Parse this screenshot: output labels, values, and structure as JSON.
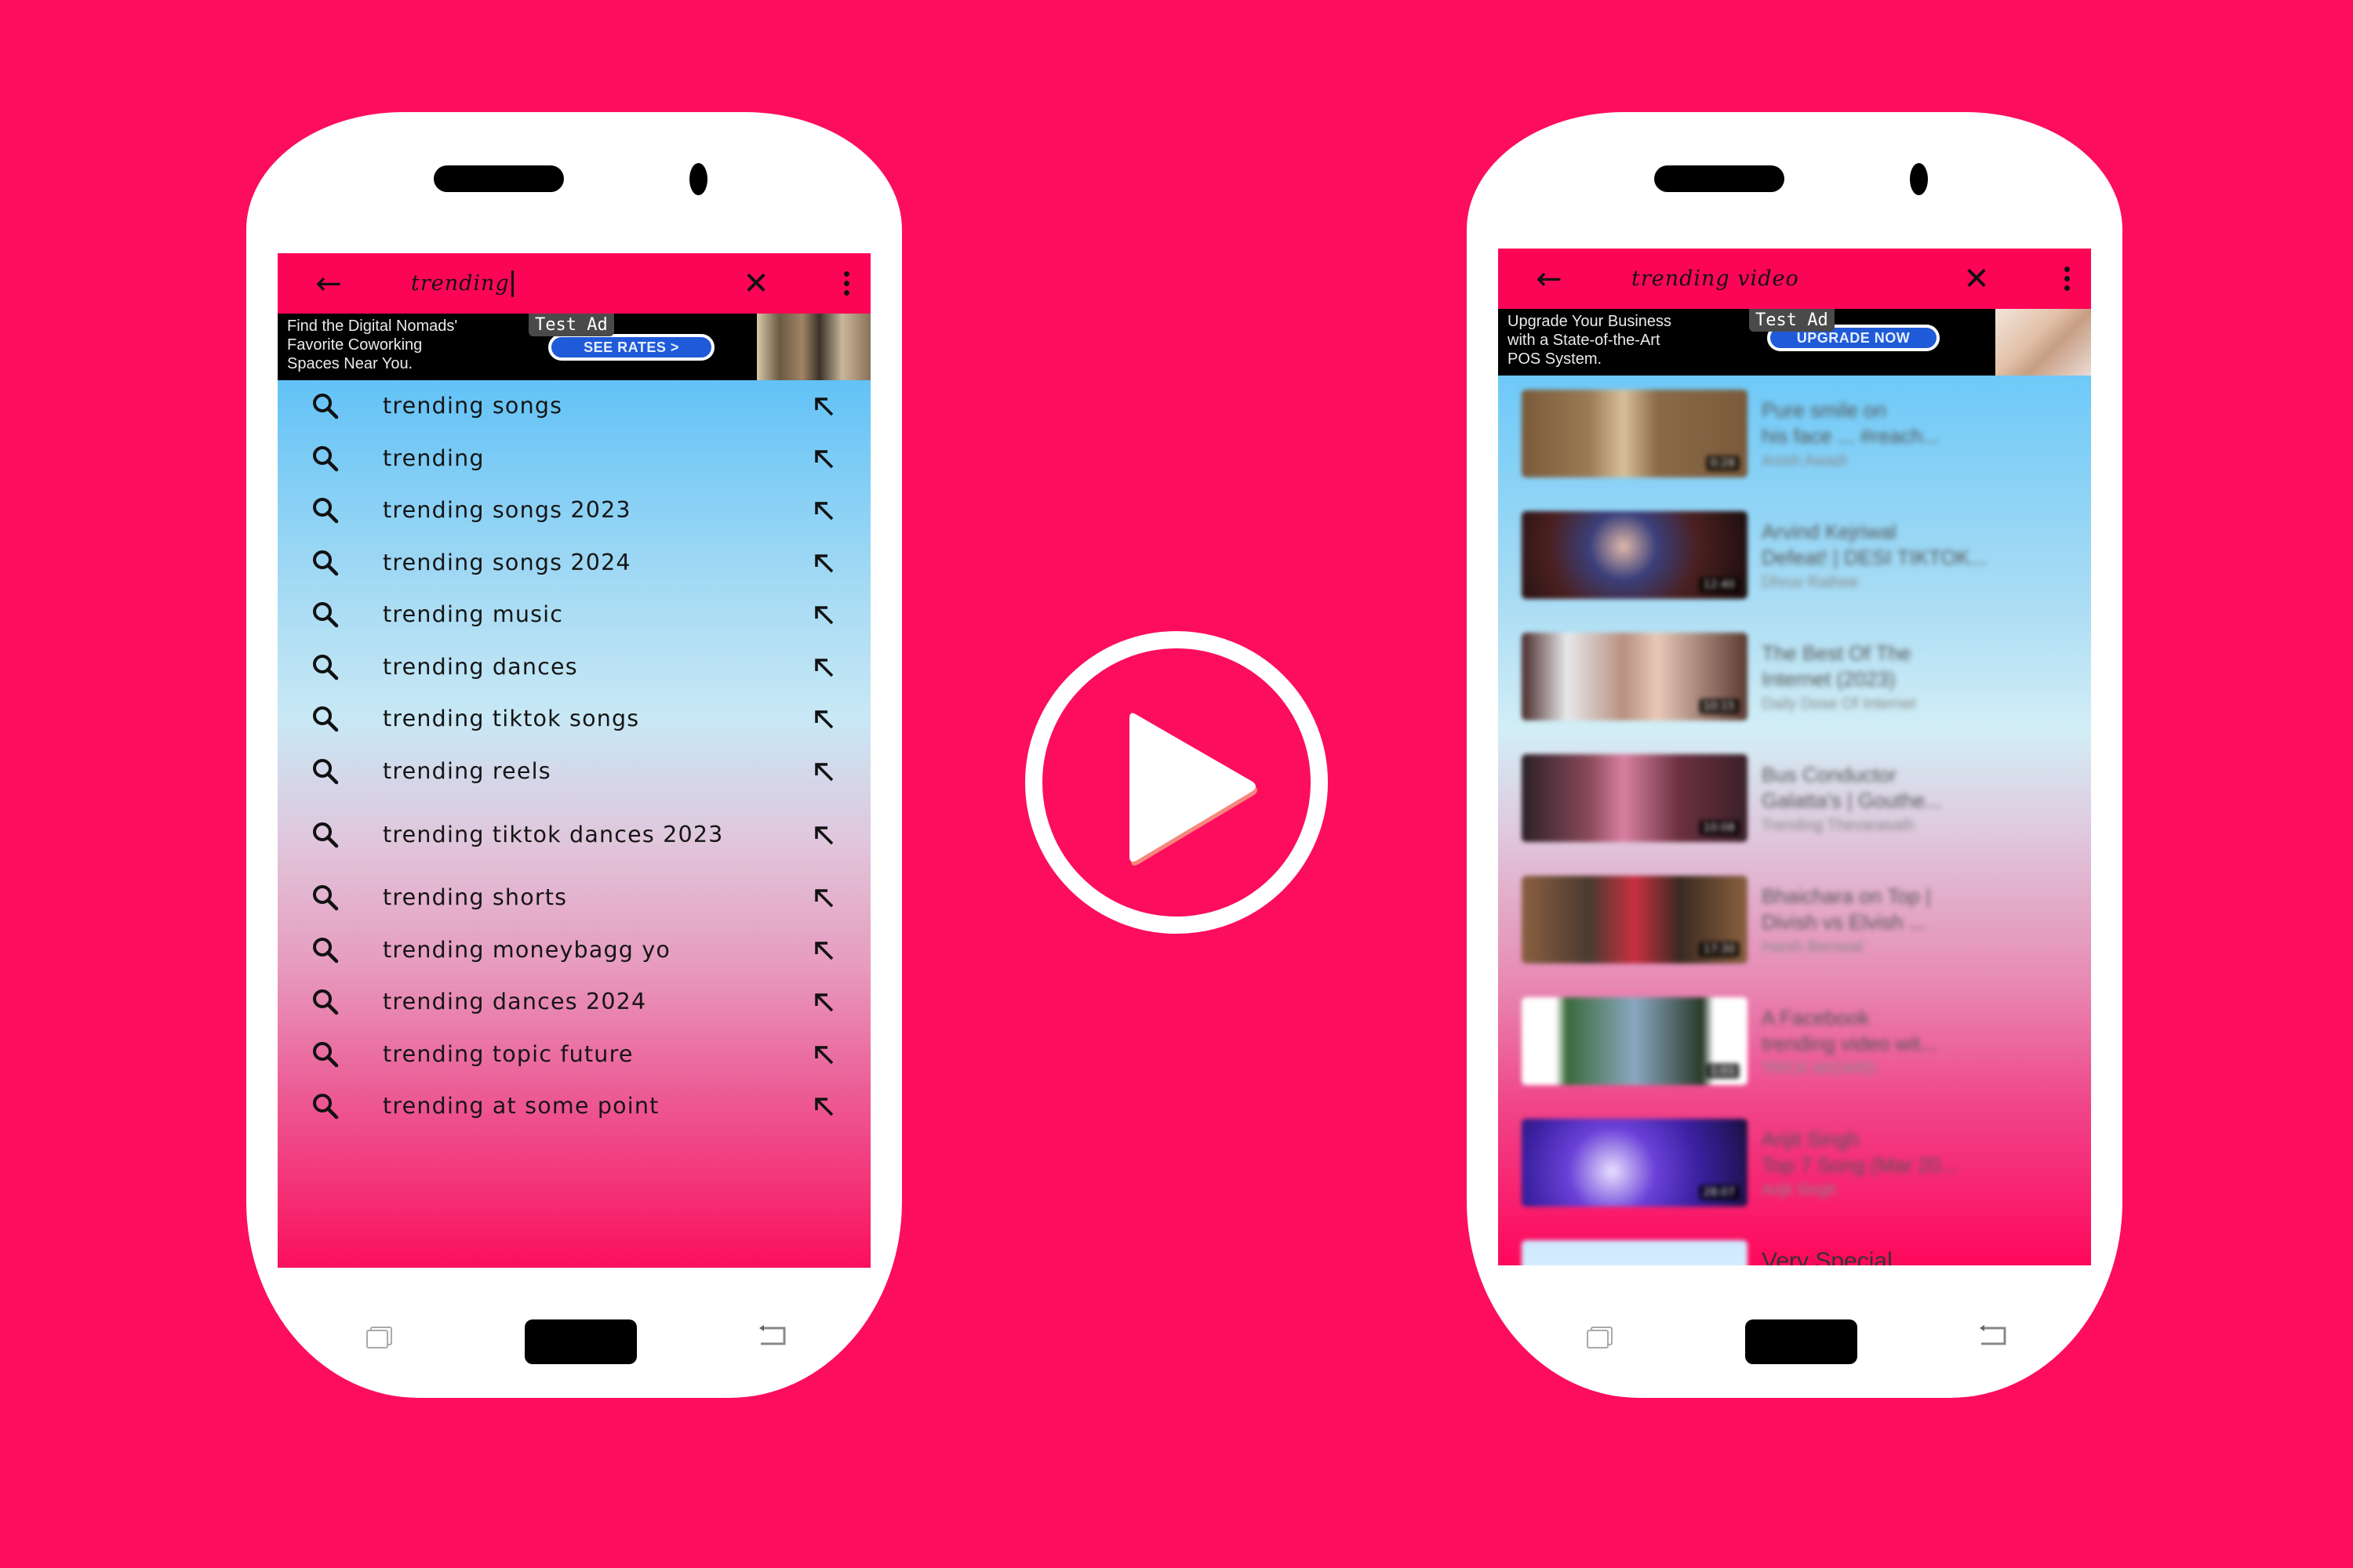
{
  "colors": {
    "background": "#fd0d5e",
    "toolbar": "#fd0557",
    "phone_body": "#ffffff",
    "ad_button": "#1f5bd8"
  },
  "left_phone": {
    "toolbar": {
      "back_icon": "arrow-left-icon",
      "query": "trending",
      "clear_icon": "close-icon",
      "more_icon": "more-vert-icon"
    },
    "ad": {
      "text_lines": [
        "Find the Digital Nomads'",
        "Favorite Coworking",
        "Spaces Near You."
      ],
      "badge": "Test Ad",
      "cta": "SEE RATES >"
    },
    "suggestions": [
      {
        "label": "trending songs"
      },
      {
        "label": "trending"
      },
      {
        "label": "trending songs 2023"
      },
      {
        "label": "trending songs 2024"
      },
      {
        "label": "trending music"
      },
      {
        "label": "trending dances"
      },
      {
        "label": "trending tiktok songs"
      },
      {
        "label": "trending reels"
      },
      {
        "label": "trending tiktok dances 2023"
      },
      {
        "label": "trending shorts"
      },
      {
        "label": "trending moneybagg yo"
      },
      {
        "label": "trending dances 2024"
      },
      {
        "label": "trending topic future"
      },
      {
        "label": "trending at some point"
      }
    ]
  },
  "right_phone": {
    "toolbar": {
      "back_icon": "arrow-left-icon",
      "query": "trending video",
      "clear_icon": "close-icon",
      "more_icon": "more-vert-icon"
    },
    "ad": {
      "text_lines": [
        "Upgrade Your Business",
        "with a State-of-the-Art",
        "POS System."
      ],
      "badge": "Test Ad",
      "cta": "UPGRADE NOW"
    },
    "videos": [
      {
        "title_1": "Pure smile on",
        "title_2": "his face ... #reach...",
        "channel": "Anish Awadi",
        "duration": "0:28"
      },
      {
        "title_1": "Arvind Kejriwal",
        "title_2": "Defeat! | DESI TIKTOK...",
        "channel": "Dhruv Rathee",
        "duration": "12:40"
      },
      {
        "title_1": "The Best Of The",
        "title_2": "Internet (2023)",
        "channel": "Daily Dose Of Internet",
        "duration": "10:15"
      },
      {
        "title_1": "Bus Conductor",
        "title_2": "Galatta's | Gouthe...",
        "channel": "Trending Thevarasath",
        "duration": "10:08"
      },
      {
        "title_1": "Bhaichara on Top |",
        "title_2": "Divish vs Elvish ...",
        "channel": "Harsh Beniwal",
        "duration": "17:30"
      },
      {
        "title_1": "A Facebook",
        "title_2": "trending video wit...",
        "channel": "TRICK WIZARD",
        "duration": "1:01"
      },
      {
        "title_1": "Arijit Singh",
        "title_2": "Top 7 Song (Mar 20...",
        "channel": "Arijit Singh",
        "duration": "28:07"
      },
      {
        "title_1": "Very Special",
        "title_2": "",
        "channel": "",
        "duration": ""
      }
    ]
  },
  "center": {
    "icon": "play-circle-icon"
  },
  "phone_nav": {
    "recent_icon": "recent-apps-icon",
    "home": "home-button",
    "back_icon": "back-icon"
  }
}
